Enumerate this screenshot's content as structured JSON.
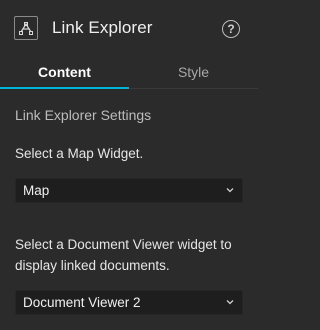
{
  "header": {
    "title": "Link Explorer",
    "widget_icon": "link-explorer-icon",
    "help_icon": "help-icon",
    "help_glyph": "?"
  },
  "tabs": [
    {
      "label": "Content",
      "active": true
    },
    {
      "label": "Style",
      "active": false
    }
  ],
  "settings": {
    "section_title": "Link Explorer Settings",
    "map_label": "Select a Map Widget.",
    "map_value": "Map",
    "doc_label": "Select a Document Viewer widget to display linked documents.",
    "doc_value": "Document Viewer 2"
  },
  "colors": {
    "background": "#2b2b2b",
    "accent": "#00b4d8",
    "select_bg": "#1e1e1e"
  }
}
